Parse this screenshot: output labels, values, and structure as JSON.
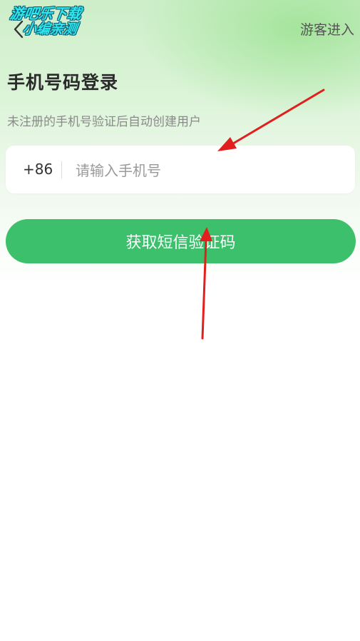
{
  "header": {
    "back_icon": "chevron-left-icon",
    "guest_label": "游客进入"
  },
  "watermark": {
    "line1": "游吧乐下载",
    "line2": "小编亲测"
  },
  "main": {
    "title": "手机号码登录",
    "subtitle": "未注册的手机号验证后自动创建用户",
    "country_code": "+86",
    "phone_placeholder": "请输入手机号",
    "phone_value": "",
    "submit_label": "获取短信验证码"
  },
  "colors": {
    "accent": "#3cc06c",
    "annotation_arrow": "#e11f1f",
    "watermark": "#2ee6ee"
  }
}
